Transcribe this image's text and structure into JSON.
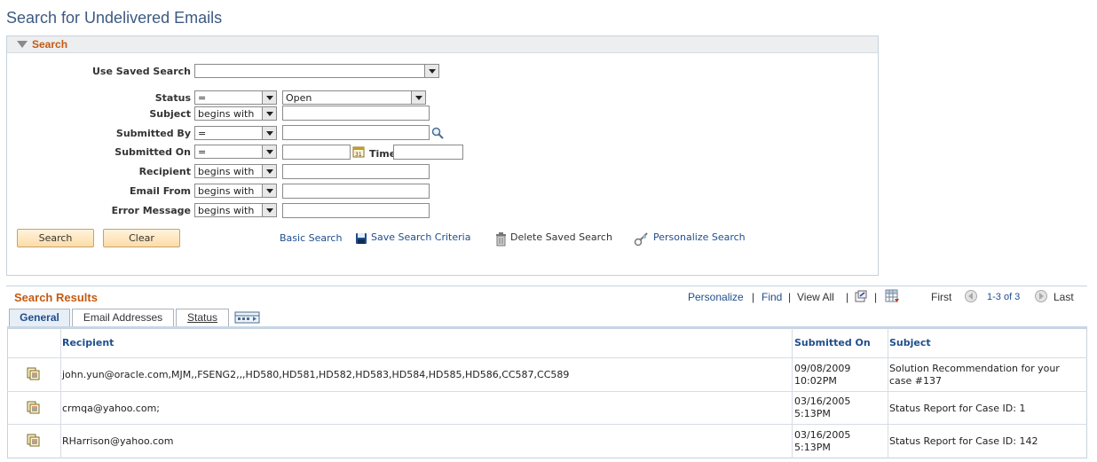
{
  "page": {
    "title": "Search for Undelivered Emails"
  },
  "search": {
    "header": "Search",
    "use_saved_label": "Use Saved Search",
    "use_saved_value": "",
    "fields": [
      {
        "label": "Status",
        "op": "=",
        "value": "Open"
      },
      {
        "label": "Subject",
        "op": "begins with",
        "value": ""
      },
      {
        "label": "Submitted By",
        "op": "=",
        "value": ""
      },
      {
        "label": "Submitted On",
        "op": "=",
        "value": "",
        "time_label": "Time",
        "time_value": ""
      },
      {
        "label": "Recipient",
        "op": "begins with",
        "value": ""
      },
      {
        "label": "Email From",
        "op": "begins with",
        "value": ""
      },
      {
        "label": "Error Message",
        "op": "begins with",
        "value": ""
      }
    ],
    "search_button": "Search",
    "clear_button": "Clear",
    "basic_search": "Basic Search",
    "save_criteria": "Save Search Criteria",
    "delete_saved": "Delete Saved Search",
    "personalize_search": "Personalize Search"
  },
  "results": {
    "title": "Search Results",
    "personalize": "Personalize",
    "find": "Find",
    "view_all": "View All",
    "sep": "|",
    "first": "First",
    "range": "1-3 of 3",
    "last": "Last",
    "tabs": [
      {
        "label": "General",
        "active": true
      },
      {
        "label": "Email Addresses",
        "active": false
      },
      {
        "label": "Status",
        "active": false
      }
    ],
    "columns": {
      "recipient": "Recipient",
      "submitted_on": "Submitted On",
      "subject": "Subject"
    },
    "rows": [
      {
        "recipient": "john.yun@oracle.com,MJM,,FSENG2,,,HD580,HD581,HD582,HD583,HD584,HD585,HD586,CC587,CC589",
        "date": "09/08/2009",
        "time": "10:02PM",
        "subject_line1": "Solution Recommendation for your",
        "subject_line2": "case #137"
      },
      {
        "recipient": "crmqa@yahoo.com;",
        "date": "03/16/2005",
        "time": "5:13PM",
        "subject_line1": "Status Report for Case ID: 1",
        "subject_line2": ""
      },
      {
        "recipient": "RHarrison@yahoo.com",
        "date": "03/16/2005",
        "time": "5:13PM",
        "subject_line1": "Status Report for Case ID: 142",
        "subject_line2": ""
      }
    ]
  },
  "colors": {
    "accent": "#c55a11",
    "link": "#1f4e8c",
    "title": "#3c5a80"
  }
}
